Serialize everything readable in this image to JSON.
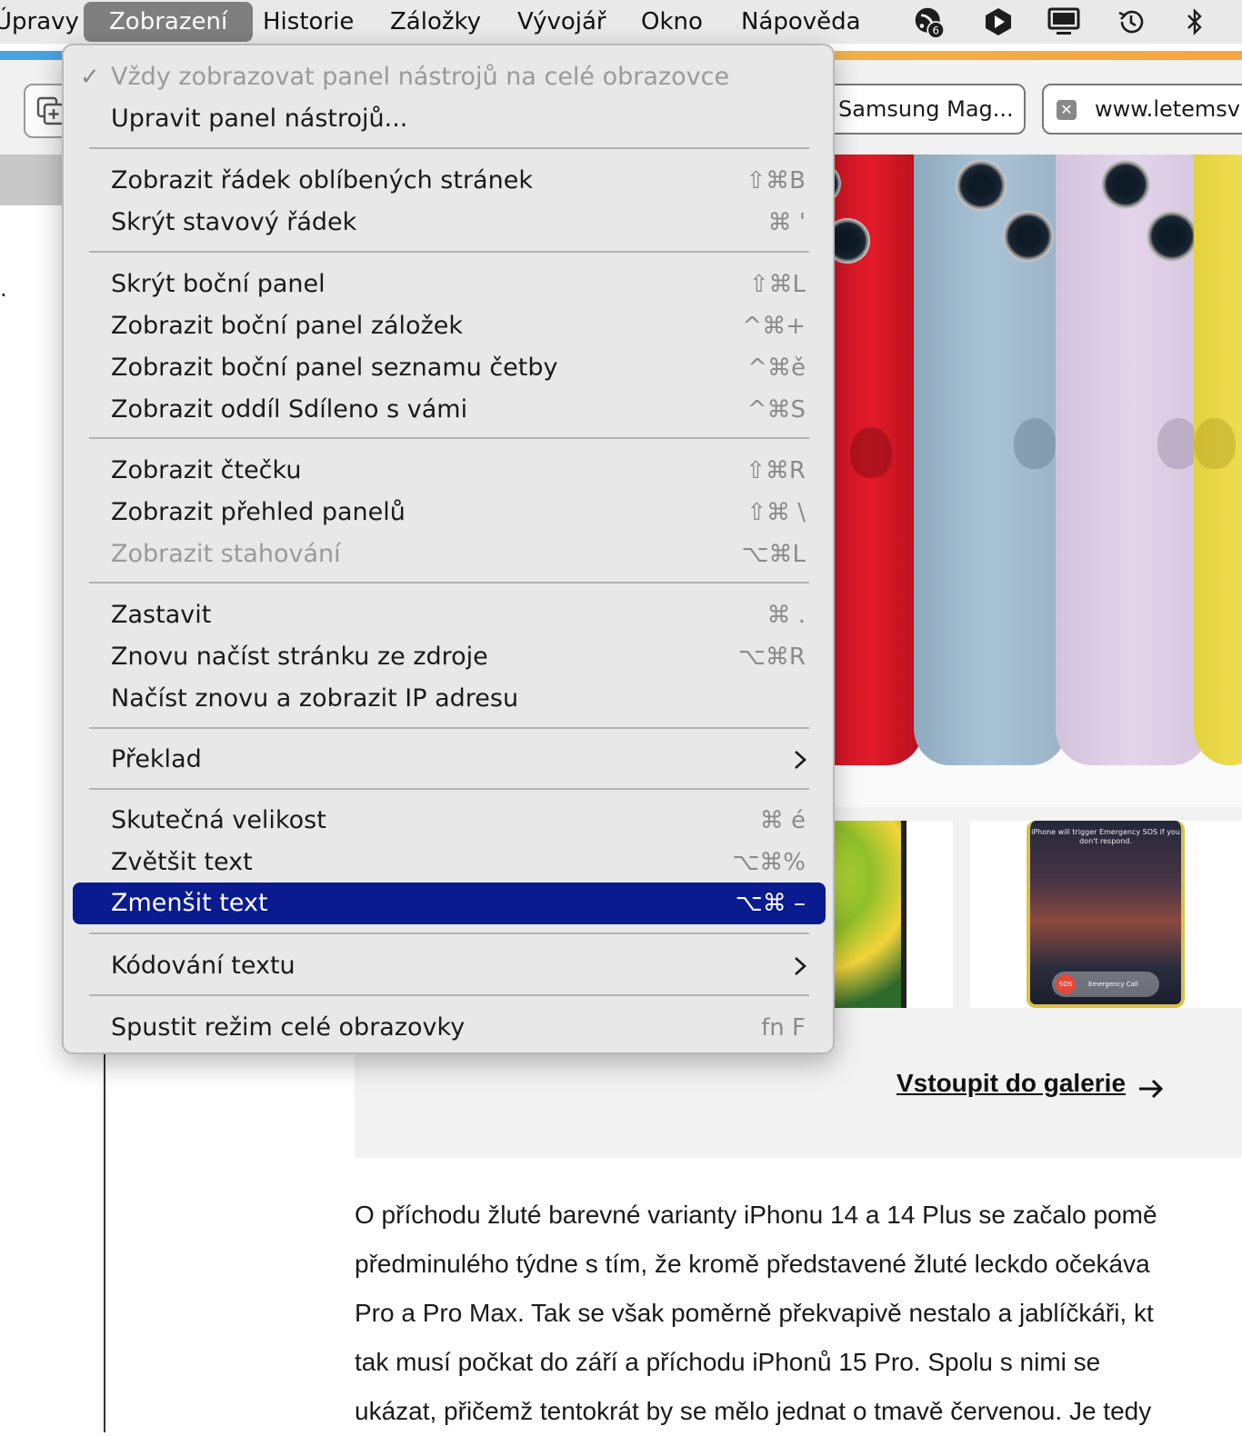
{
  "menubar": {
    "items": [
      "Úpravy",
      "Zobrazení",
      "Historie",
      "Záložky",
      "Vývojář",
      "Okno",
      "Nápověda"
    ],
    "active_index": 1,
    "status_icons": [
      "rss-badge-icon",
      "shield-play-icon",
      "display-icon",
      "time-machine-icon",
      "bluetooth-icon"
    ],
    "badge_count": "6"
  },
  "tabs": [
    {
      "title": "Samsung Mag..."
    },
    {
      "title": "www.letemsv"
    }
  ],
  "menu": {
    "items": [
      {
        "label": "Vždy zobrazovat panel nástrojů na celé obrazovce",
        "shortcut": "",
        "checked": true,
        "disabled": true
      },
      {
        "label": "Upravit panel nástrojů...",
        "shortcut": ""
      },
      {
        "label": "Zobrazit řádek oblíbených stránek",
        "shortcut": "⇧⌘B"
      },
      {
        "label": "Skrýt stavový řádek",
        "shortcut": "⌘ '"
      },
      {
        "label": "Skrýt boční panel",
        "shortcut": "⇧⌘L"
      },
      {
        "label": "Zobrazit boční panel záložek",
        "shortcut": "^⌘+"
      },
      {
        "label": "Zobrazit boční panel seznamu četby",
        "shortcut": "^⌘ě"
      },
      {
        "label": "Zobrazit oddíl Sdíleno s vámi",
        "shortcut": "^⌘S"
      },
      {
        "label": "Zobrazit čtečku",
        "shortcut": "⇧⌘R"
      },
      {
        "label": "Zobrazit přehled panelů",
        "shortcut": "⇧⌘ \\"
      },
      {
        "label": "Zobrazit stahování",
        "shortcut": "⌥⌘L",
        "disabled": true
      },
      {
        "label": "Zastavit",
        "shortcut": "⌘ ."
      },
      {
        "label": "Znovu načíst stránku ze zdroje",
        "shortcut": "⌥⌘R"
      },
      {
        "label": "Načíst znovu a zobrazit IP adresu",
        "shortcut": ""
      },
      {
        "label": "Překlad",
        "submenu": true
      },
      {
        "label": "Skutečná velikost",
        "shortcut": "⌘ é"
      },
      {
        "label": "Zvětšit text",
        "shortcut": "⌥⌘%"
      },
      {
        "label": "Zmenšit text",
        "shortcut": "⌥⌘ –",
        "selected": true
      },
      {
        "label": "Kódování textu",
        "submenu": true
      },
      {
        "label": "Spustit režim celé obrazovky",
        "shortcut": "fn F"
      }
    ]
  },
  "gallery": {
    "link": "Vstoupit do galerie",
    "thumb_sos_text": "iPhone will trigger Emergency SOS if you don't respond.",
    "thumb_sos_label": "SOS",
    "thumb_call_label": "Emergency Call"
  },
  "article": {
    "lines": [
      "O příchodu žluté barevné varianty iPhonu 14 a 14 Plus se začalo pomě",
      "předminulého týdne s tím, že kromě představené žluté leckdo očekáva",
      "Pro a Pro Max. Tak se však poměrně překvapivě nestalo a jablíčkáři, kt",
      "tak musí počkat do září a příchodu iPhonů 15 Pro. Spolu s nimi se",
      "ukázat, přičemž tentokrát by se mělo jednat o tmavě červenou. Je tedy"
    ]
  },
  "colors": {
    "menu_selected": "#0a1a8f",
    "phone_red": "#e21b2a",
    "phone_blue": "#a9c3d6",
    "phone_purple": "#e3d4ea",
    "phone_yellow": "#f3e35a"
  }
}
